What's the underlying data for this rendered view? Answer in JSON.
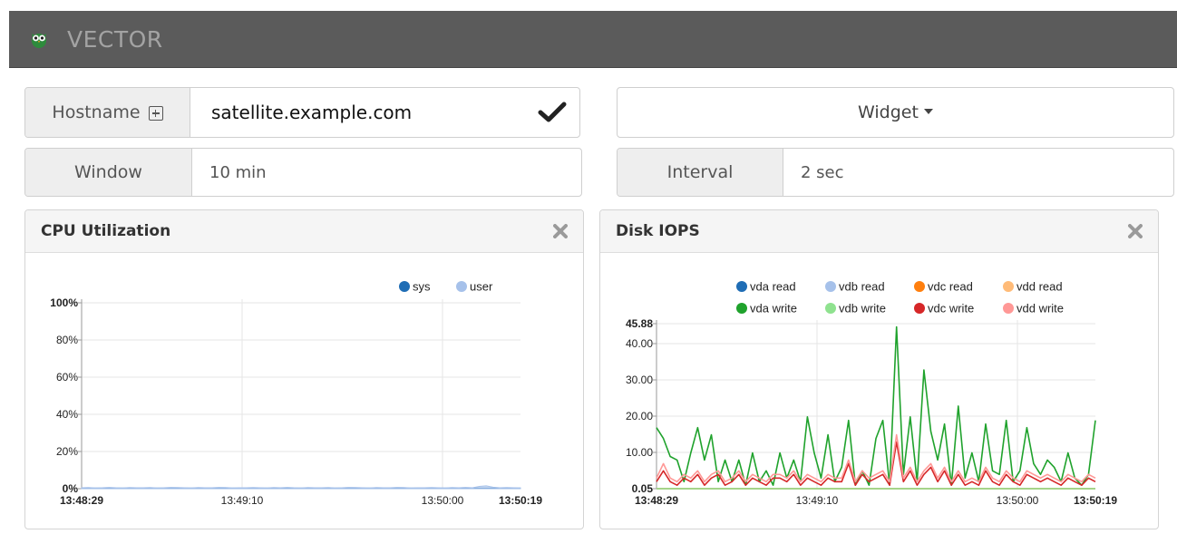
{
  "app": {
    "brand": "VECTOR"
  },
  "controls": {
    "hostname": {
      "label": "Hostname",
      "value": "satellite.example.com"
    },
    "window": {
      "label": "Window",
      "value": "10 min"
    },
    "widget": {
      "label": "Widget"
    },
    "interval": {
      "label": "Interval",
      "value": "2 sec"
    }
  },
  "panels": {
    "cpu": {
      "title": "CPU Utilization"
    },
    "disk": {
      "title": "Disk IOPS"
    }
  },
  "colors": {
    "accent_bar": "#5b5b5b",
    "vda_read": "#1f6db5",
    "vdb_read": "#a6c1ea",
    "vdc_read": "#ff7f0e",
    "vdd_read": "#ffbb78",
    "vda_write": "#1fa22c",
    "vdb_write": "#8fe28f",
    "vdc_write": "#d62728",
    "vdd_write": "#ff9896"
  },
  "chart_data": [
    {
      "type": "area",
      "title": "CPU Utilization",
      "x_tick_labels": [
        "13:48:29",
        "13:49:10",
        "13:50:00",
        "13:50:19"
      ],
      "y_tick_labels": [
        "0%",
        "20%",
        "40%",
        "60%",
        "80%",
        "100%"
      ],
      "ylim": [
        0,
        100
      ],
      "grid": true,
      "legend_position": "top-right",
      "series": [
        {
          "name": "sys",
          "color": "#1f6db5",
          "values": [
            0.3,
            0.3,
            0.3,
            0.3,
            0.3,
            0.3,
            0.3,
            0.3,
            0.3,
            0.3,
            0.3,
            0.3,
            0.3,
            0.3,
            0.3,
            0.3,
            0.3,
            0.3,
            0.3,
            0.3,
            0.3,
            0.3,
            0.3,
            0.3,
            0.3,
            0.3,
            0.3,
            0.3,
            0.3,
            0.3,
            0.3,
            0.3,
            0.3,
            0.3,
            0.3,
            0.3,
            0.3,
            0.3,
            0.3,
            0.3,
            0.3,
            0.3,
            0.3,
            0.3,
            0.3,
            0.3,
            0.3,
            0.3,
            0.3,
            0.3,
            0.3,
            0.3,
            0.3,
            0.3,
            0.3,
            0.3,
            0.3,
            0.3,
            0.3,
            0.3,
            0.3,
            0.3,
            0.3,
            0.3,
            0.3
          ]
        },
        {
          "name": "user",
          "color": "#a6c1ea",
          "values": [
            0.5,
            0.6,
            0.4,
            0.5,
            0.7,
            0.5,
            0.4,
            0.6,
            0.5,
            0.5,
            0.6,
            0.4,
            0.5,
            0.7,
            0.6,
            0.5,
            0.4,
            0.6,
            0.5,
            0.5,
            0.7,
            0.6,
            0.4,
            0.5,
            0.5,
            0.6,
            0.5,
            0.4,
            0.6,
            0.5,
            0.7,
            0.5,
            0.4,
            0.6,
            0.5,
            0.5,
            0.6,
            0.4,
            0.5,
            0.7,
            0.6,
            0.5,
            0.4,
            0.6,
            0.5,
            0.5,
            0.7,
            0.6,
            0.4,
            0.5,
            0.5,
            0.6,
            0.5,
            0.4,
            0.6,
            0.5,
            0.7,
            0.5,
            1.2,
            1.5,
            0.8,
            0.5,
            0.6,
            0.5,
            0.4
          ]
        }
      ]
    },
    {
      "type": "line",
      "title": "Disk IOPS",
      "x_tick_labels": [
        "13:48:29",
        "13:49:10",
        "13:50:00",
        "13:50:19"
      ],
      "y_tick_labels": [
        "0.05",
        "10.00",
        "20.00",
        "30.00",
        "40.00",
        "45.88"
      ],
      "ylim": [
        0.05,
        45.88
      ],
      "grid": true,
      "legend_position": "top",
      "series": [
        {
          "name": "vda read",
          "color": "#1f6db5",
          "values": [
            0,
            0,
            0,
            0,
            0,
            0,
            0,
            0,
            0,
            0,
            0,
            0,
            0,
            0,
            0,
            0,
            0,
            0,
            0,
            0,
            0,
            0,
            0,
            0,
            0,
            0,
            0,
            0,
            0,
            0,
            0,
            0,
            0,
            0,
            0,
            0,
            0,
            0,
            0,
            0,
            0,
            0,
            0,
            0,
            0,
            0,
            0,
            0,
            0,
            0,
            0,
            0,
            0,
            0,
            0,
            0,
            0,
            0,
            0,
            0,
            0,
            0,
            0,
            0,
            0
          ]
        },
        {
          "name": "vdb read",
          "color": "#a6c1ea",
          "values": [
            0,
            0,
            0,
            0,
            0,
            0,
            0,
            0,
            0,
            0,
            0,
            0,
            0,
            0,
            0,
            0,
            0,
            0,
            0,
            0,
            0,
            0,
            0,
            0,
            0,
            0,
            0,
            0,
            0,
            0,
            0,
            0,
            0,
            0,
            0,
            0,
            0,
            0,
            0,
            0,
            0,
            0,
            0,
            0,
            0,
            0,
            0,
            0,
            0,
            0,
            0,
            0,
            0,
            0,
            0,
            0,
            0,
            0,
            0,
            0,
            0,
            0,
            0,
            0,
            0
          ]
        },
        {
          "name": "vdc read",
          "color": "#ff7f0e",
          "values": [
            0,
            0,
            0,
            0,
            0,
            0,
            0,
            0,
            0,
            0,
            0,
            0,
            0,
            0,
            0,
            0,
            0,
            0,
            0,
            0,
            0,
            0,
            0,
            0,
            0,
            0,
            0,
            0,
            0,
            0,
            0,
            0,
            0,
            0,
            0,
            0,
            0,
            0,
            0,
            0,
            0,
            0,
            0,
            0,
            0,
            0,
            0,
            0,
            0,
            0,
            0,
            0,
            0,
            0,
            0,
            0,
            0,
            0,
            0,
            0,
            0,
            0,
            0,
            0,
            0
          ]
        },
        {
          "name": "vdd read",
          "color": "#ffbb78",
          "values": [
            0,
            0,
            0,
            0,
            0,
            0,
            0,
            0,
            0,
            0,
            0,
            0,
            0,
            0,
            0,
            0,
            0,
            0,
            0,
            0,
            0,
            0,
            0,
            0,
            0,
            0,
            0,
            0,
            0,
            0,
            0,
            0,
            0,
            0,
            0,
            0,
            0,
            0,
            0,
            0,
            0,
            0,
            0,
            0,
            0,
            0,
            0,
            0,
            0,
            0,
            0,
            0,
            0,
            0,
            0,
            0,
            0,
            0,
            0,
            0,
            0,
            0,
            0,
            0,
            0
          ]
        },
        {
          "name": "vda write",
          "color": "#1fa22c",
          "values": [
            17,
            14,
            9,
            8,
            2,
            10,
            17,
            8,
            15,
            2,
            8,
            2,
            8,
            1,
            10,
            2,
            5,
            1,
            10,
            3,
            8,
            2,
            20,
            10,
            3,
            15,
            2,
            6,
            19,
            1,
            5,
            1,
            14,
            19,
            1,
            45,
            4,
            20,
            2,
            33,
            16,
            8,
            18,
            1,
            23,
            3,
            10,
            2,
            18,
            5,
            4,
            19,
            2,
            5,
            17,
            7,
            4,
            8,
            6,
            2,
            10,
            3,
            1,
            4,
            19
          ]
        },
        {
          "name": "vdb write",
          "color": "#8fe28f",
          "values": [
            0,
            0,
            0,
            0,
            0,
            0,
            0,
            0,
            0,
            0,
            0,
            0,
            0,
            0,
            0,
            0,
            0,
            0,
            0,
            0,
            0,
            0,
            0,
            0,
            0,
            0,
            0,
            0,
            0,
            0,
            0,
            0,
            0,
            0,
            0,
            0,
            0,
            0,
            0,
            0,
            0,
            0,
            0,
            0,
            0,
            0,
            0,
            0,
            0,
            0,
            0,
            0,
            0,
            0,
            0,
            0,
            0,
            0,
            0,
            0,
            0,
            0,
            0,
            0,
            0
          ]
        },
        {
          "name": "vdc write",
          "color": "#d62728",
          "values": [
            2,
            5,
            2,
            1,
            3,
            2,
            4,
            1,
            3,
            4,
            1,
            2,
            4,
            1,
            3,
            2,
            1,
            3,
            3,
            2,
            4,
            1,
            3,
            2,
            1,
            3,
            2,
            2,
            7,
            1,
            4,
            2,
            3,
            4,
            1,
            13,
            2,
            5,
            1,
            4,
            6,
            2,
            5,
            1,
            4,
            1,
            2,
            1,
            5,
            2,
            1,
            4,
            2,
            1,
            4,
            3,
            2,
            3,
            2,
            1,
            3,
            2,
            1,
            3,
            2
          ]
        },
        {
          "name": "vdd write",
          "color": "#ff9896",
          "values": [
            3,
            7,
            3,
            2,
            4,
            3,
            5,
            2,
            4,
            5,
            2,
            3,
            5,
            2,
            4,
            3,
            2,
            4,
            4,
            3,
            5,
            2,
            4,
            3,
            2,
            4,
            3,
            3,
            8,
            2,
            5,
            3,
            4,
            5,
            2,
            15,
            3,
            6,
            2,
            5,
            7,
            3,
            6,
            2,
            5,
            2,
            3,
            2,
            6,
            3,
            2,
            5,
            3,
            2,
            5,
            4,
            3,
            4,
            3,
            2,
            4,
            3,
            2,
            4,
            3
          ]
        }
      ]
    }
  ]
}
